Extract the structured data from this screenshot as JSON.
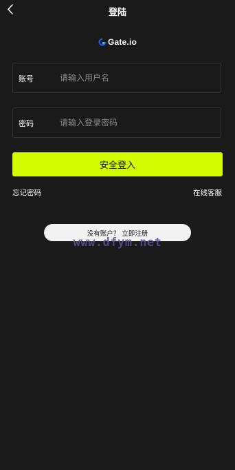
{
  "header": {
    "title": "登陆",
    "back_icon": "chevron-left-icon"
  },
  "logo": {
    "text": "Gate.io",
    "mark_color": "#2354e6"
  },
  "form": {
    "username": {
      "label": "账号",
      "placeholder": "请输入用户名",
      "value": ""
    },
    "password": {
      "label": "密码",
      "placeholder": "请输入登录密码",
      "value": ""
    },
    "submit_label": "安全登入"
  },
  "links": {
    "forgot_password": "忘记密码",
    "online_support": "在线客服"
  },
  "toast": {
    "text": "没有账户？ 立即注册"
  },
  "watermark": {
    "text": "www.dfym.net"
  },
  "colors": {
    "background": "#1a1a1a",
    "accent": "#d4fc00",
    "field_border": "#333333"
  }
}
